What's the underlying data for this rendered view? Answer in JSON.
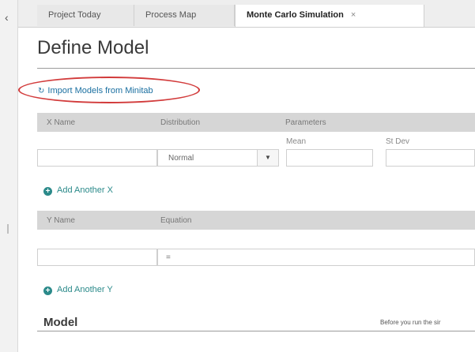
{
  "nav": {
    "back_icon": "chevron-left-icon"
  },
  "tabs": [
    {
      "label": "Project Today"
    },
    {
      "label": "Process Map"
    },
    {
      "label": "Monte Carlo Simulation",
      "close": "×"
    }
  ],
  "page": {
    "title": "Define Model"
  },
  "import": {
    "label": "Import Models from Minitab",
    "icon": "refresh-icon"
  },
  "annotation": {
    "color": "#d23b3b"
  },
  "x_table": {
    "headers": {
      "name": "X Name",
      "distribution": "Distribution",
      "parameters": "Parameters"
    },
    "param_labels": {
      "mean": "Mean",
      "stdev": "St Dev"
    },
    "row": {
      "name": "",
      "distribution": "Normal",
      "mean": "",
      "stdev": ""
    }
  },
  "add_x": {
    "label": "Add Another X"
  },
  "y_table": {
    "headers": {
      "name": "Y Name",
      "equation": "Equation"
    },
    "row": {
      "name": "",
      "equation": "="
    }
  },
  "add_y": {
    "label": "Add Another Y"
  },
  "model": {
    "title": "Model",
    "note": "Before you run the sir"
  },
  "colors": {
    "accent": "#2b8a8a",
    "link": "#1a6fa0",
    "header_bg": "#d6d6d6"
  }
}
